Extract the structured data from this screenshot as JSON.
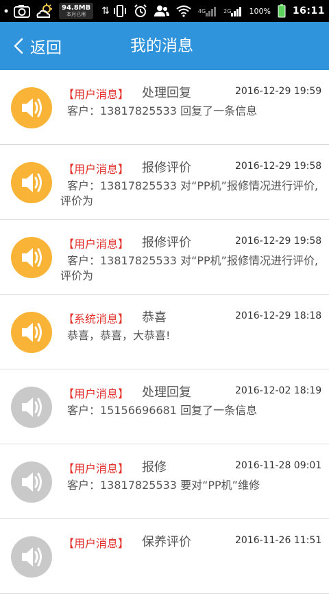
{
  "status_bar": {
    "net_speed": "94.8MB",
    "net_sub": "本月已用",
    "net_type": "4G",
    "net_type2": "2G",
    "battery": "100%",
    "time": "16:11"
  },
  "header": {
    "back_label": "返回",
    "title": "我的消息",
    "bg_color": "#2f94dc"
  },
  "colors": {
    "unread_icon": "#f9b437",
    "read_icon": "#c9c9c9",
    "type_label": "#e3302a"
  },
  "messages": [
    {
      "type": "【用户消息】",
      "title": "处理回复",
      "time": "2016-12-29 19:59",
      "body": "客户：13817825533 回复了一条信息",
      "read": false
    },
    {
      "type": "【用户消息】",
      "title": "报修评价",
      "time": "2016-12-29 19:58",
      "body": "客户：13817825533 对“PP机”报修情况进行评价,评价为",
      "read": false
    },
    {
      "type": "【用户消息】",
      "title": "报修评价",
      "time": "2016-12-29 19:58",
      "body": "客户：13817825533 对“PP机”报修情况进行评价,评价为",
      "read": false
    },
    {
      "type": "【系统消息】",
      "title": "恭喜",
      "time": "2016-12-29 18:18",
      "body": "恭喜，恭喜，大恭喜!",
      "read": false
    },
    {
      "type": "【用户消息】",
      "title": "处理回复",
      "time": "2016-12-02 18:19",
      "body": "客户：15156696681 回复了一条信息",
      "read": true
    },
    {
      "type": "【用户消息】",
      "title": "报修",
      "time": "2016-11-28 09:01",
      "body": "客户：13817825533 要对“PP机”维修",
      "read": true
    },
    {
      "type": "【用户消息】",
      "title": "保养评价",
      "time": "2016-11-26 11:51",
      "body": "",
      "read": true
    }
  ]
}
